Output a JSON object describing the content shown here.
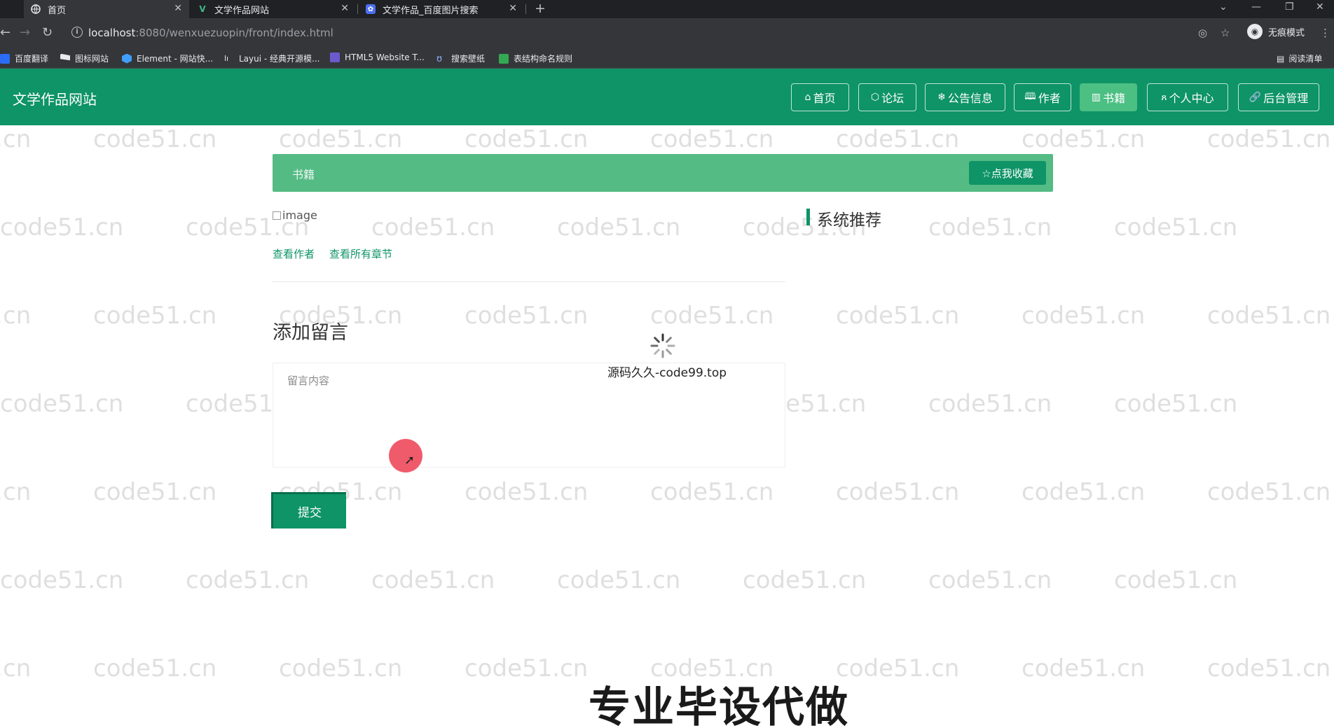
{
  "browser": {
    "tabs": [
      {
        "label": "首页",
        "icon": "globe-icon",
        "active": true
      },
      {
        "label": "文学作品网站",
        "icon": "vue-v-icon",
        "active": false
      },
      {
        "label": "文学作品_百度图片搜索",
        "icon": "baidu-paw-icon",
        "active": false
      }
    ],
    "url_host": "localhost",
    "url_rest": ":8080/wenxuezuopin/front/index.html",
    "incognito_label": "无痕模式",
    "bookmarks": [
      "百度翻译",
      "图标网站",
      "Element - 网站快...",
      "Layui - 经典开源模...",
      "HTML5 Website T...",
      "搜索壁纸",
      "表结构命名规则"
    ],
    "reading_list": "阅读清单"
  },
  "site": {
    "title": "文学作品网站",
    "nav": [
      {
        "label": "首页",
        "icon": "home-icon",
        "glyph": "⌂"
      },
      {
        "label": "论坛",
        "icon": "cube-icon",
        "glyph": "⬡"
      },
      {
        "label": "公告信息",
        "icon": "snowflake-icon",
        "glyph": "❄"
      },
      {
        "label": "作者",
        "icon": "book-open-icon",
        "glyph": "🕮"
      },
      {
        "label": "书籍",
        "icon": "book-icon",
        "glyph": "▥",
        "active": true
      },
      {
        "label": "个人中心",
        "icon": "user-icon",
        "glyph": "ጸ"
      },
      {
        "label": "后台管理",
        "icon": "link-icon",
        "glyph": "🔗"
      }
    ]
  },
  "detail": {
    "banner_title": "书籍",
    "favorite_label": "☆点我收藏",
    "image_alt": "image",
    "view_author": "查看作者",
    "view_chapters": "查看所有章节"
  },
  "comment": {
    "heading": "添加留言",
    "placeholder": "留言内容",
    "submit": "提交"
  },
  "recommend": {
    "heading": "系统推荐"
  },
  "loading": {
    "text": "源码久久-code99.top"
  },
  "overlay": {
    "caption": "专业毕设代做",
    "watermark": "code51.cn"
  },
  "colors": {
    "primary": "#0e9466",
    "banner": "#55bb85",
    "active_nav": "#4cbf83"
  }
}
